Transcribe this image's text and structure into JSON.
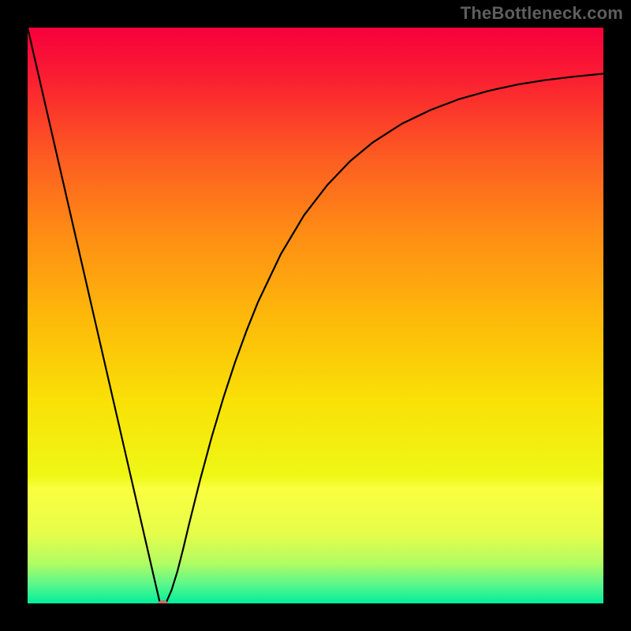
{
  "attribution": "TheBottleneck.com",
  "colors": {
    "page_bg": "#000000",
    "attribution_text": "#5e5e5e",
    "curve": "#000000",
    "marker": "#d46a6a"
  },
  "chart_data": {
    "type": "line",
    "title": "",
    "xlabel": "",
    "ylabel": "",
    "xlim": [
      0,
      100
    ],
    "ylim": [
      0,
      100
    ],
    "gradient_stops": [
      {
        "offset": 0.0,
        "color": "#f7003c"
      },
      {
        "offset": 0.08,
        "color": "#fa1b32"
      },
      {
        "offset": 0.22,
        "color": "#fd5a22"
      },
      {
        "offset": 0.35,
        "color": "#fe8a15"
      },
      {
        "offset": 0.5,
        "color": "#fdb80a"
      },
      {
        "offset": 0.65,
        "color": "#f9e106"
      },
      {
        "offset": 0.78,
        "color": "#eef816"
      },
      {
        "offset": 0.8,
        "color": "#fafe3f"
      },
      {
        "offset": 0.88,
        "color": "#e5fd4a"
      },
      {
        "offset": 0.93,
        "color": "#b2fc62"
      },
      {
        "offset": 0.965,
        "color": "#5ff78a"
      },
      {
        "offset": 1.0,
        "color": "#02ee9b"
      }
    ],
    "series": [
      {
        "name": "curve",
        "x": [
          0,
          2,
          4,
          6,
          8,
          10,
          12,
          14,
          16,
          18,
          20,
          22,
          23,
          24,
          25,
          26,
          27,
          28,
          30,
          32,
          34,
          36,
          38,
          40,
          44,
          48,
          52,
          56,
          60,
          65,
          70,
          75,
          80,
          85,
          90,
          95,
          100
        ],
        "y": [
          100,
          91.3,
          82.6,
          73.9,
          65.2,
          56.5,
          47.8,
          39.1,
          30.4,
          21.7,
          13.0,
          4.3,
          0.0,
          0.0,
          2.3,
          5.5,
          9.4,
          13.6,
          21.6,
          29.0,
          35.7,
          41.8,
          47.3,
          52.3,
          60.7,
          67.4,
          72.6,
          76.8,
          80.1,
          83.3,
          85.7,
          87.6,
          89.0,
          90.1,
          90.9,
          91.5,
          92.0
        ]
      }
    ],
    "minimum_marker": {
      "x": 23.5,
      "y": 0.0
    }
  }
}
